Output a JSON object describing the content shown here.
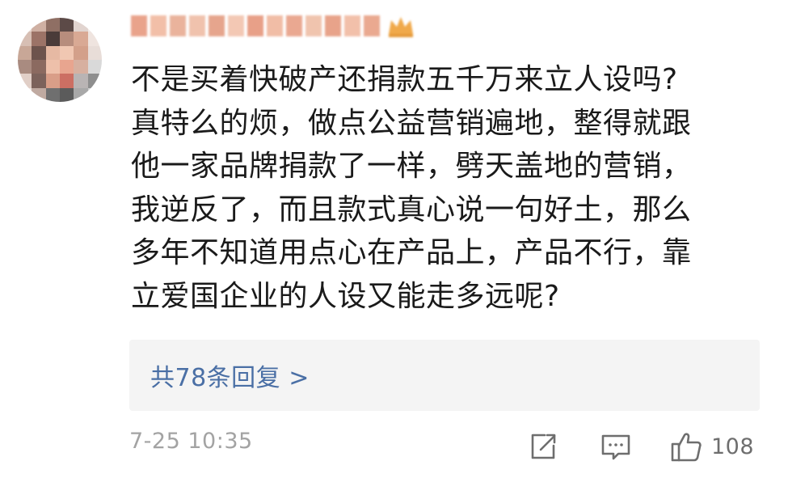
{
  "comment": {
    "lines": [
      "不是买着快破产还捐款五千万来立人设吗?",
      "真特么的烦，做点公益营销遍地，整得就跟",
      "他一家品牌捐款了一样，劈天盖地的营销，",
      "我逆反了，而且款式真心说一句好土，那么",
      "多年不知道用点心在产品上，产品不行，靠",
      "立爱国企业的人设又能走多远呢?"
    ]
  },
  "replies": {
    "label": "共78条回复 >"
  },
  "footer": {
    "timestamp": "7-25 10:35",
    "like_count": "108"
  },
  "icons": {
    "share": "share-icon",
    "comment": "comment-icon",
    "like": "thumbs-up-icon"
  },
  "colors": {
    "text": "#1a1a1a",
    "link": "#4a6fa5",
    "muted": "#a3a3a3",
    "icon": "#6e6e6e",
    "reply_bg": "#f4f4f4"
  }
}
